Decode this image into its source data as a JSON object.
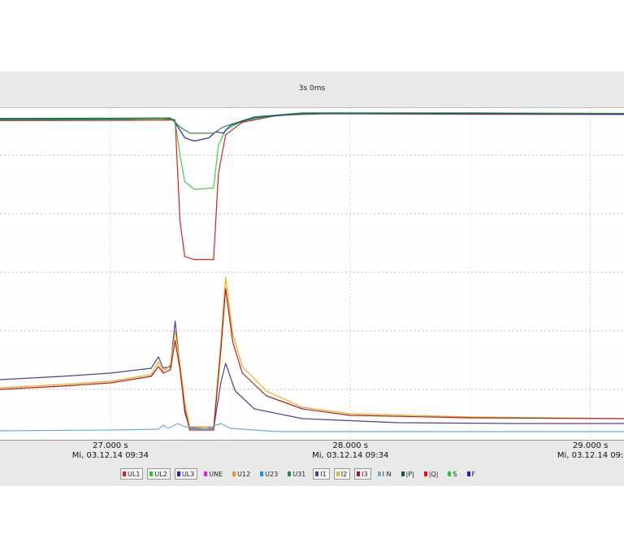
{
  "header": {
    "duration_label": "3s 0ms"
  },
  "chart_data": {
    "type": "line",
    "grid": true,
    "legend_placement": "bottom",
    "xlim": [
      26.54,
      29.14
    ],
    "x_ticks": [
      {
        "value": 27.0,
        "label": "27.000 s",
        "sublabel": "Mi, 03.12.14 09:34"
      },
      {
        "value": 28.0,
        "label": "28.000 s",
        "sublabel": "Mi, 03.12.14 09:34"
      },
      {
        "value": 29.0,
        "label": "29.000 s",
        "sublabel": "Mi, 03.12.14 09:"
      }
    ],
    "upper_ylim": [
      0,
      1
    ],
    "lower_ylim": [
      0,
      1
    ],
    "series": [
      {
        "name": "UL1",
        "color": "#d42020",
        "panel": "upper",
        "points": [
          [
            26.54,
            0.94
          ],
          [
            27.0,
            0.942
          ],
          [
            27.27,
            0.945
          ],
          [
            27.29,
            0.3
          ],
          [
            27.31,
            0.07
          ],
          [
            27.35,
            0.05
          ],
          [
            27.43,
            0.05
          ],
          [
            27.45,
            0.6
          ],
          [
            27.48,
            0.85
          ],
          [
            27.55,
            0.93
          ],
          [
            27.7,
            0.975
          ],
          [
            27.9,
            0.985
          ],
          [
            28.5,
            0.982
          ],
          [
            29.14,
            0.98
          ]
        ]
      },
      {
        "name": "UL2",
        "color": "#3ad13a",
        "panel": "upper",
        "points": [
          [
            26.54,
            0.945
          ],
          [
            27.0,
            0.946
          ],
          [
            27.21,
            0.952
          ],
          [
            27.24,
            0.95
          ],
          [
            27.27,
            0.94
          ],
          [
            27.29,
            0.72
          ],
          [
            27.31,
            0.55
          ],
          [
            27.35,
            0.5
          ],
          [
            27.43,
            0.51
          ],
          [
            27.45,
            0.78
          ],
          [
            27.48,
            0.88
          ],
          [
            27.55,
            0.94
          ],
          [
            27.7,
            0.975
          ],
          [
            27.9,
            0.988
          ],
          [
            28.5,
            0.985
          ],
          [
            29.14,
            0.983
          ]
        ]
      },
      {
        "name": "UL3",
        "color": "#2a2ab8",
        "panel": "upper",
        "points": [
          [
            26.54,
            0.95
          ],
          [
            27.0,
            0.951
          ],
          [
            27.22,
            0.958
          ],
          [
            27.26,
            0.95
          ],
          [
            27.29,
            0.88
          ],
          [
            27.31,
            0.83
          ],
          [
            27.35,
            0.81
          ],
          [
            27.41,
            0.83
          ],
          [
            27.44,
            0.87
          ],
          [
            27.47,
            0.86
          ],
          [
            27.5,
            0.91
          ],
          [
            27.6,
            0.96
          ],
          [
            27.8,
            0.985
          ],
          [
            28.5,
            0.985
          ],
          [
            29.14,
            0.982
          ]
        ]
      },
      {
        "name": "U31",
        "color": "#2f8a3a",
        "panel": "upper",
        "points": [
          [
            26.54,
            0.955
          ],
          [
            27.0,
            0.956
          ],
          [
            27.25,
            0.958
          ],
          [
            27.29,
            0.9
          ],
          [
            27.33,
            0.86
          ],
          [
            27.43,
            0.86
          ],
          [
            27.47,
            0.9
          ],
          [
            27.6,
            0.965
          ],
          [
            27.8,
            0.99
          ],
          [
            28.5,
            0.99
          ],
          [
            29.14,
            0.987
          ]
        ]
      },
      {
        "name": "I1",
        "color": "#50428a",
        "panel": "lower",
        "points": [
          [
            26.54,
            0.32
          ],
          [
            26.8,
            0.34
          ],
          [
            27.0,
            0.36
          ],
          [
            27.17,
            0.39
          ],
          [
            27.2,
            0.46
          ],
          [
            27.22,
            0.39
          ],
          [
            27.25,
            0.4
          ],
          [
            27.27,
            0.68
          ],
          [
            27.29,
            0.4
          ],
          [
            27.31,
            0.12
          ],
          [
            27.33,
            0.02
          ],
          [
            27.43,
            0.02
          ],
          [
            27.46,
            0.3
          ],
          [
            27.48,
            0.42
          ],
          [
            27.52,
            0.25
          ],
          [
            27.6,
            0.14
          ],
          [
            27.8,
            0.08
          ],
          [
            28.2,
            0.055
          ],
          [
            28.7,
            0.05
          ],
          [
            29.14,
            0.05
          ]
        ]
      },
      {
        "name": "I2",
        "color": "#f2a818",
        "panel": "lower",
        "points": [
          [
            26.54,
            0.27
          ],
          [
            26.8,
            0.29
          ],
          [
            27.0,
            0.31
          ],
          [
            27.17,
            0.35
          ],
          [
            27.2,
            0.43
          ],
          [
            27.22,
            0.37
          ],
          [
            27.25,
            0.41
          ],
          [
            27.27,
            0.62
          ],
          [
            27.29,
            0.42
          ],
          [
            27.31,
            0.18
          ],
          [
            27.33,
            0.03
          ],
          [
            27.43,
            0.03
          ],
          [
            27.46,
            0.55
          ],
          [
            27.48,
            0.95
          ],
          [
            27.51,
            0.6
          ],
          [
            27.55,
            0.4
          ],
          [
            27.65,
            0.25
          ],
          [
            27.8,
            0.15
          ],
          [
            28.0,
            0.11
          ],
          [
            28.5,
            0.09
          ],
          [
            29.14,
            0.08
          ]
        ]
      },
      {
        "name": "I3",
        "color": "#a82020",
        "panel": "lower",
        "points": [
          [
            26.54,
            0.26
          ],
          [
            26.8,
            0.28
          ],
          [
            27.0,
            0.3
          ],
          [
            27.17,
            0.34
          ],
          [
            27.2,
            0.4
          ],
          [
            27.22,
            0.36
          ],
          [
            27.25,
            0.38
          ],
          [
            27.27,
            0.56
          ],
          [
            27.29,
            0.38
          ],
          [
            27.31,
            0.14
          ],
          [
            27.33,
            0.01
          ],
          [
            27.43,
            0.01
          ],
          [
            27.46,
            0.5
          ],
          [
            27.48,
            0.88
          ],
          [
            27.51,
            0.55
          ],
          [
            27.55,
            0.36
          ],
          [
            27.65,
            0.22
          ],
          [
            27.8,
            0.14
          ],
          [
            28.0,
            0.1
          ],
          [
            28.5,
            0.085
          ],
          [
            29.14,
            0.08
          ]
        ]
      },
      {
        "name": "I N",
        "color": "#6aaedc",
        "panel": "lower",
        "points": [
          [
            26.54,
            0.005
          ],
          [
            27.0,
            0.01
          ],
          [
            27.2,
            0.015
          ],
          [
            27.22,
            0.04
          ],
          [
            27.24,
            0.02
          ],
          [
            27.28,
            0.05
          ],
          [
            27.31,
            0.03
          ],
          [
            27.4,
            0.02
          ],
          [
            27.46,
            0.05
          ],
          [
            27.5,
            0.02
          ],
          [
            27.7,
            0.0
          ],
          [
            29.14,
            0.0
          ]
        ]
      }
    ]
  },
  "legend": [
    {
      "label": "UL1",
      "color": "#e01818",
      "boxed": true
    },
    {
      "label": "UL2",
      "color": "#22cc22",
      "boxed": true
    },
    {
      "label": "UL3",
      "color": "#2020c0",
      "boxed": true
    },
    {
      "label": "UNE",
      "color": "#e020e0",
      "boxed": false
    },
    {
      "label": "U12",
      "color": "#f09020",
      "boxed": false
    },
    {
      "label": "U23",
      "color": "#2090e0",
      "boxed": false
    },
    {
      "label": "U31",
      "color": "#2a8a3a",
      "boxed": false
    },
    {
      "label": "I1",
      "color": "#50428a",
      "boxed": true
    },
    {
      "label": "I2",
      "color": "#f2b030",
      "boxed": true
    },
    {
      "label": "I3",
      "color": "#b01818",
      "boxed": true
    },
    {
      "label": "I N",
      "color": "#70b0e0",
      "boxed": false
    },
    {
      "label": "|P|",
      "color": "#1a5a3a",
      "boxed": false
    },
    {
      "label": "|Q|",
      "color": "#e01818",
      "boxed": false
    },
    {
      "label": "S",
      "color": "#22cc22",
      "boxed": false
    },
    {
      "label": "F",
      "color": "#2020c0",
      "boxed": false
    }
  ]
}
